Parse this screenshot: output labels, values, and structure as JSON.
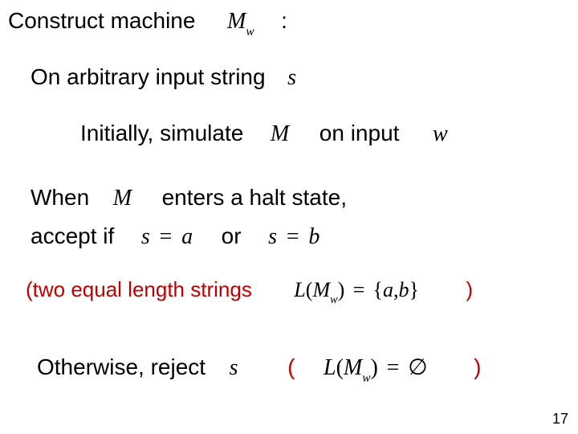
{
  "line1": {
    "construct": "Construct machine",
    "M": "M",
    "Msub": "w",
    "colon": ":"
  },
  "line2": {
    "on_input": "On arbitrary input string",
    "s": "s"
  },
  "line3": {
    "initially": "Initially, simulate",
    "M": "M",
    "on_input": "on input",
    "w": "w"
  },
  "line4": {
    "when": "When",
    "M": "M",
    "enters": "enters a halt state,"
  },
  "line5": {
    "accept_if": "accept if",
    "eq1_lhs": "s",
    "eq1_op": "=",
    "eq1_rhs": "a",
    "or": "or",
    "eq2_lhs": "s",
    "eq2_op": "=",
    "eq2_rhs": "b"
  },
  "line6": {
    "two_equal": "(two equal length strings",
    "L": "L",
    "lp": "(",
    "M": "M",
    "Msub": "w",
    "rp": ")",
    "eq": "=",
    "lb": "{",
    "a": "a",
    "comma": ",",
    "b": "b",
    "rb": "}",
    "close": ")"
  },
  "line7": {
    "otherwise": "Otherwise, reject",
    "s": "s",
    "lp": "(",
    "L": "L",
    "lp2": "(",
    "M": "M",
    "Msub": "w",
    "rp2": ")",
    "eq": "=",
    "empty": "∅",
    "close": ")"
  },
  "pagenum": "17"
}
